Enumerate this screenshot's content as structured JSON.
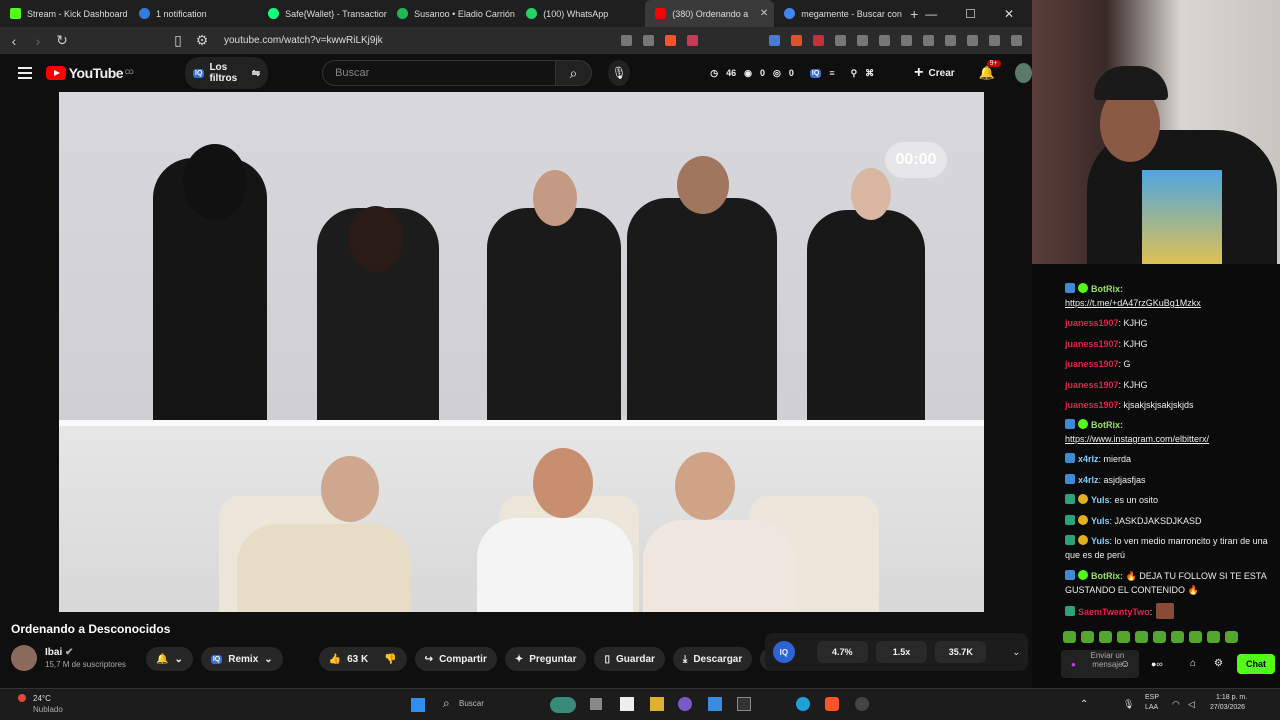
{
  "tabs": [
    {
      "label": "Stream - Kick Dashboard",
      "color": "#53fc18"
    },
    {
      "label": "1 notification",
      "color": "#2f7de1"
    },
    {
      "label": "Safe{Wallet} - Transaction q",
      "color": "#12ff80"
    },
    {
      "label": "Susanoo • Eladio Carrión",
      "color": "#1db954"
    },
    {
      "label": "(100) WhatsApp",
      "color": "#25d366"
    },
    {
      "label": "(380) Ordenando a",
      "color": "#ff0000"
    },
    {
      "label": "megamente - Buscar con G",
      "color": "#4285f4"
    }
  ],
  "address": {
    "url": "youtube.com/watch?v=kwwRiLKj9jk"
  },
  "yt": {
    "logo": "YouTube",
    "country": "CO",
    "filters": "Los filtros",
    "search_placeholder": "Buscar",
    "stat1": "46",
    "stat2": "0",
    "stat3": "0",
    "create": "Crear",
    "notif_count": "9+"
  },
  "video": {
    "timer": "00:00"
  },
  "watch": {
    "title": "Ordenando a Desconocidos",
    "channel": "Ibai",
    "subs": "15,7 M de suscriptores",
    "remix": "Remix",
    "likes": "63 K",
    "share": "Compartir",
    "ask": "Preguntar",
    "save": "Guardar",
    "download": "Descargar"
  },
  "iq": {
    "logo": "IQ",
    "v1": "4.7%",
    "v2": "1.5x",
    "v3": "35.7K"
  },
  "chat": {
    "messages": [
      {
        "user": "BotRix:",
        "text": "",
        "color": "#9ae06a"
      },
      {
        "user": "",
        "text": "https://t.me/+dA47rzGKuBg1Mzkx",
        "color": "#9ae06a"
      },
      {
        "user": "juaness1907",
        "text": ": KJHG",
        "color": "#e0244b"
      },
      {
        "user": "juaness1907",
        "text": ": KJHG",
        "color": "#e0244b"
      },
      {
        "user": "juaness1907",
        "text": ": G",
        "color": "#e0244b"
      },
      {
        "user": "juaness1907",
        "text": ": KJHG",
        "color": "#e0244b"
      },
      {
        "user": "juaness1907",
        "text": ": kjsakjskjsakjskjds",
        "color": "#e0244b"
      },
      {
        "user": "BotRix:",
        "text": "",
        "color": "#9ae06a"
      },
      {
        "user": "",
        "text": "https://www.instagram.com/elbitterx/",
        "color": "#9ae06a"
      },
      {
        "user": "x4rlz",
        "text": ": mierda",
        "color": "#7ed0ff"
      },
      {
        "user": "x4rlz",
        "text": ": asjdjasfjas",
        "color": "#7ed0ff"
      },
      {
        "user": "Yuls",
        "text": ": es un osito",
        "color": "#7ed0ff"
      },
      {
        "user": "Yuls",
        "text": ": JASKDJAKSDJKASD",
        "color": "#7ed0ff"
      },
      {
        "user": "Yuls",
        "text": ": lo ven medio marroncito y tiran de una que es de perú",
        "color": "#7ed0ff"
      },
      {
        "user": "BotRix:",
        "text": " 🔥 DEJA TU FOLLOW SI TE ESTA GUSTANDO EL CONTENIDO 🔥",
        "color": "#9ae06a"
      },
      {
        "user": "SaemTwentyTwo",
        "text": ":",
        "color": "#e0244b"
      }
    ],
    "input_placeholder": "Enviar un mensaje",
    "send": "Chat"
  },
  "taskbar": {
    "temp": "24°C",
    "weather": "Nublado",
    "search": "Buscar",
    "lang1": "ESP",
    "lang2": "LAA",
    "time": "1:18 p. m.",
    "date": "27/03/2026"
  }
}
